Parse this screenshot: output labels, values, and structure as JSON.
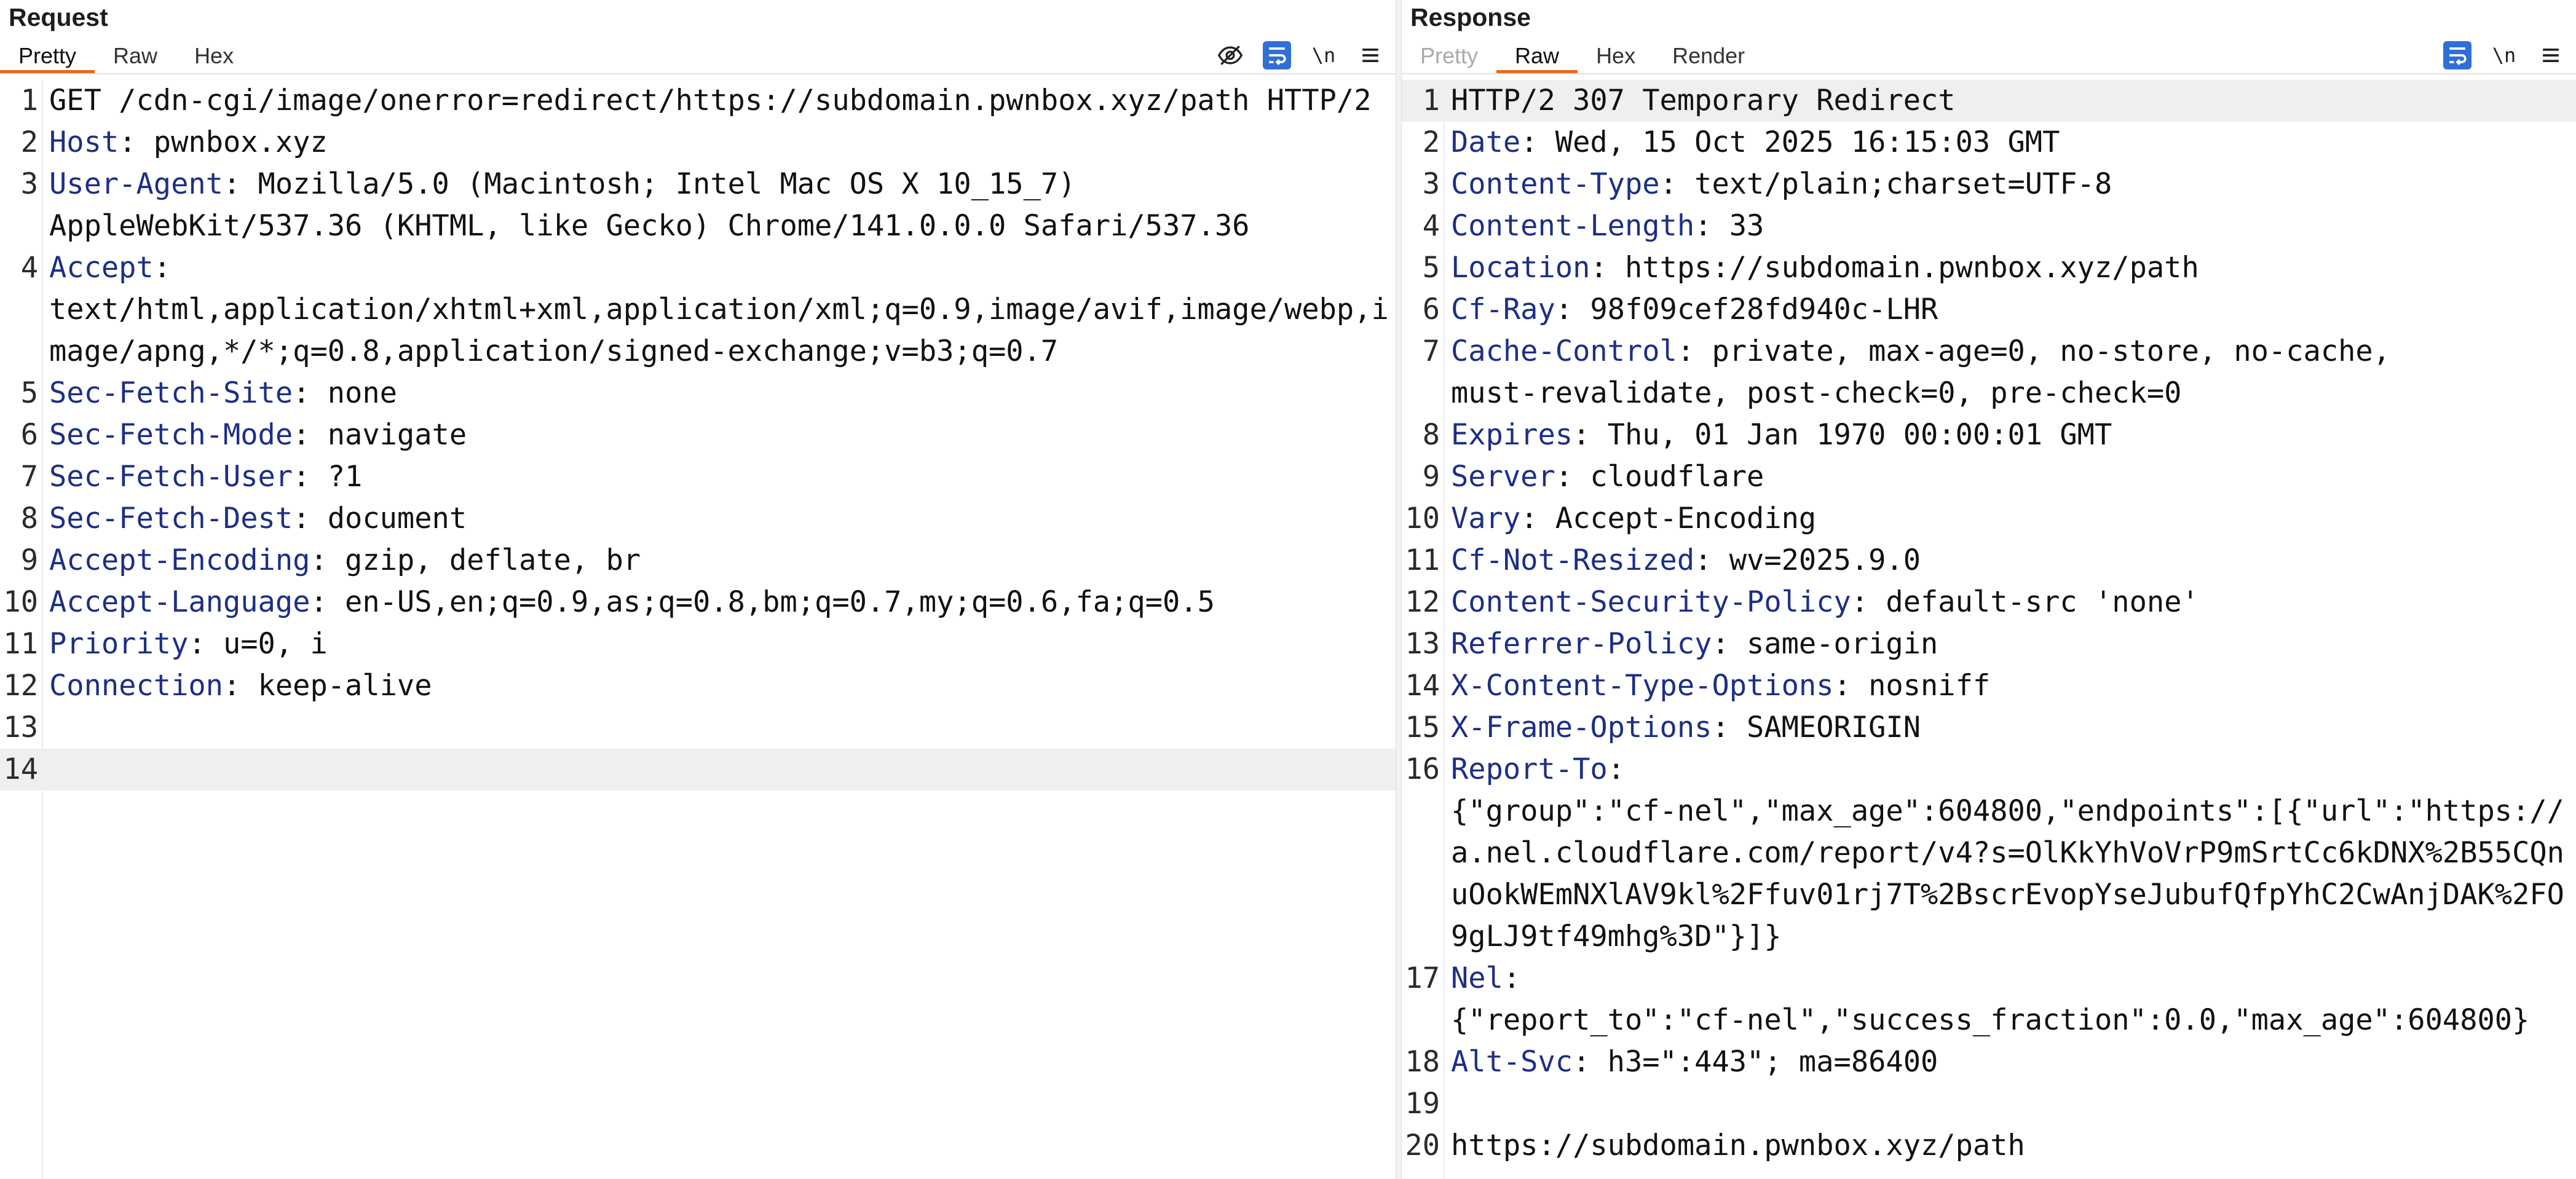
{
  "request": {
    "title": "Request",
    "tabs": [
      "Pretty",
      "Raw",
      "Hex"
    ],
    "active_tab": "Pretty",
    "tools": {
      "hide": "eye-slash-icon",
      "wrap": "word-wrap-icon",
      "newline": "\\n",
      "menu": "hamburger-menu-icon"
    },
    "lines": [
      {
        "n": "1",
        "text": "GET /cdn-cgi/image/onerror=redirect/https://subdomain.pwnbox.xyz/path HTTP/2"
      },
      {
        "n": "2",
        "name": "Host",
        "value": " pwnbox.xyz"
      },
      {
        "n": "3",
        "name": "User-Agent",
        "value": " Mozilla/5.0 (Macintosh; Intel Mac OS X 10_15_7)",
        "cont": [
          "AppleWebKit/537.36 (KHTML, like Gecko) Chrome/141.0.0.0 Safari/537.36"
        ]
      },
      {
        "n": "4",
        "name": "Accept",
        "value": "",
        "cont": [
          "text/html,application/xhtml+xml,application/xml;q=0.9,image/avif,image/webp,i",
          "mage/apng,*/*;q=0.8,application/signed-exchange;v=b3;q=0.7"
        ]
      },
      {
        "n": "5",
        "name": "Sec-Fetch-Site",
        "value": " none"
      },
      {
        "n": "6",
        "name": "Sec-Fetch-Mode",
        "value": " navigate"
      },
      {
        "n": "7",
        "name": "Sec-Fetch-User",
        "value": " ?1"
      },
      {
        "n": "8",
        "name": "Sec-Fetch-Dest",
        "value": " document"
      },
      {
        "n": "9",
        "name": "Accept-Encoding",
        "value": " gzip, deflate, br"
      },
      {
        "n": "10",
        "name": "Accept-Language",
        "value": " en-US,en;q=0.9,as;q=0.8,bm;q=0.7,my;q=0.6,fa;q=0.5"
      },
      {
        "n": "11",
        "name": "Priority",
        "value": " u=0, i"
      },
      {
        "n": "12",
        "name": "Connection",
        "value": " keep-alive"
      },
      {
        "n": "13",
        "text": ""
      },
      {
        "n": "14",
        "text": "",
        "highlight": true
      }
    ]
  },
  "response": {
    "title": "Response",
    "tabs": [
      "Pretty",
      "Raw",
      "Hex",
      "Render"
    ],
    "active_tab": "Raw",
    "disabled_tab": "Pretty",
    "tools": {
      "wrap": "word-wrap-icon",
      "newline": "\\n",
      "menu": "hamburger-menu-icon"
    },
    "lines": [
      {
        "n": "1",
        "text": "HTTP/2 307 Temporary Redirect",
        "highlight": true
      },
      {
        "n": "2",
        "name": "Date",
        "value": " Wed, 15 Oct 2025 16:15:03 GMT"
      },
      {
        "n": "3",
        "name": "Content-Type",
        "value": " text/plain;charset=UTF-8"
      },
      {
        "n": "4",
        "name": "Content-Length",
        "value": " 33"
      },
      {
        "n": "5",
        "name": "Location",
        "value": " https://subdomain.pwnbox.xyz/path"
      },
      {
        "n": "6",
        "name": "Cf-Ray",
        "value": " 98f09cef28fd940c-LHR"
      },
      {
        "n": "7",
        "name": "Cache-Control",
        "value": " private, max-age=0, no-store, no-cache,",
        "cont": [
          "must-revalidate, post-check=0, pre-check=0"
        ]
      },
      {
        "n": "8",
        "name": "Expires",
        "value": " Thu, 01 Jan 1970 00:00:01 GMT"
      },
      {
        "n": "9",
        "name": "Server",
        "value": " cloudflare"
      },
      {
        "n": "10",
        "name": "Vary",
        "value": " Accept-Encoding"
      },
      {
        "n": "11",
        "name": "Cf-Not-Resized",
        "value": " wv=2025.9.0"
      },
      {
        "n": "12",
        "name": "Content-Security-Policy",
        "value": " default-src 'none'"
      },
      {
        "n": "13",
        "name": "Referrer-Policy",
        "value": " same-origin"
      },
      {
        "n": "14",
        "name": "X-Content-Type-Options",
        "value": " nosniff"
      },
      {
        "n": "15",
        "name": "X-Frame-Options",
        "value": " SAMEORIGIN"
      },
      {
        "n": "16",
        "name": "Report-To",
        "value": "",
        "cont": [
          "{\"group\":\"cf-nel\",\"max_age\":604800,\"endpoints\":[{\"url\":\"https://",
          "a.nel.cloudflare.com/report/v4?s=OlKkYhVoVrP9mSrtCc6kDNX%2B55CQn",
          "uOokWEmNXlAV9kl%2Ffuv01rj7T%2BscrEvopYseJubufQfpYhC2CwAnjDAK%2FO",
          "9gLJ9tf49mhg%3D\"}]}"
        ]
      },
      {
        "n": "17",
        "name": "Nel",
        "value": "",
        "cont": [
          "{\"report_to\":\"cf-nel\",\"success_fraction\":0.0,\"max_age\":604800}"
        ]
      },
      {
        "n": "18",
        "name": "Alt-Svc",
        "value": " h3=\":443\"; ma=86400"
      },
      {
        "n": "19",
        "text": ""
      },
      {
        "n": "20",
        "text": "https://subdomain.pwnbox.xyz/path"
      }
    ]
  }
}
